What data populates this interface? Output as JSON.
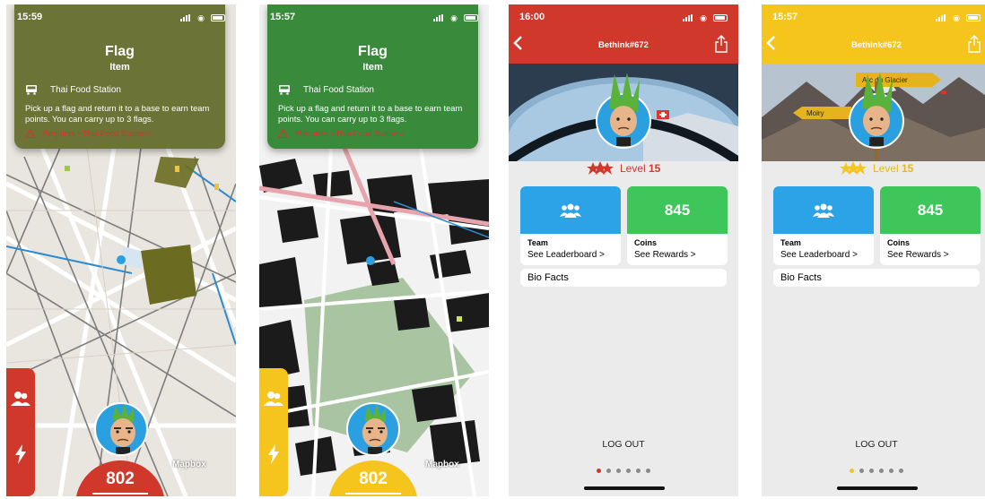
{
  "screens": [
    {
      "time": "15:59",
      "panel": {
        "title": "Flag",
        "subtitle": "Item",
        "location": "Thai Food Station",
        "description": "Pick up a flag and return it to a base to earn team points. You can carry up to 3 flags.",
        "requirement": "Requires <Thai Food Station>",
        "color": "#6b7337"
      },
      "score": "802",
      "score_color": "#d0382b",
      "attribution": "Mapbox"
    },
    {
      "time": "15:57",
      "panel": {
        "title": "Flag",
        "subtitle": "Item",
        "location": "Thai Food Station",
        "description": "Pick up a flag and return it to a base to earn team points. You can carry up to 3 flags.",
        "requirement": "Requires <Thai Food Station>",
        "color": "#3a8a3c"
      },
      "score": "802",
      "score_color": "#f5c51e",
      "attribution": "Mapbox"
    },
    {
      "time": "16:00",
      "title": "Bethink#672",
      "header_color": "#d0382b",
      "level_word": "Level",
      "level_num": "15",
      "team_label": "Team",
      "team_link": "See Leaderboard >",
      "coins_value": "845",
      "coins_label": "Coins",
      "coins_link": "See Rewards >",
      "bio": "Bio Facts",
      "logout": "LOG OUT"
    },
    {
      "time": "15:57",
      "title": "Bethink#672",
      "header_color": "#f5c51e",
      "level_word": "Level",
      "level_num": "15",
      "team_label": "Team",
      "team_link": "See Leaderboard >",
      "coins_value": "845",
      "coins_label": "Coins",
      "coins_link": "See Rewards >",
      "bio": "Bio Facts",
      "logout": "LOG OUT"
    }
  ],
  "signs": {
    "top": "Arc du Glacier",
    "left": "Moiry"
  },
  "colors": {
    "team_blue": "#2ba3e6",
    "coins_green": "#3fc65a"
  }
}
